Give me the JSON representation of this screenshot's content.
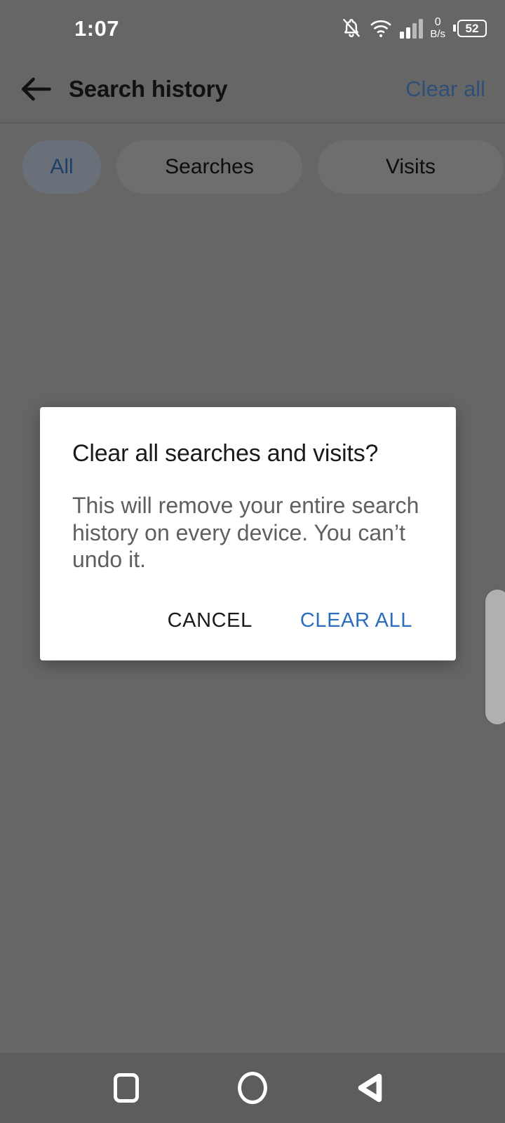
{
  "status_bar": {
    "time": "1:07",
    "network_rate": "0",
    "network_unit": "B/s",
    "battery_level": "52",
    "icons": [
      "notifications-off-icon",
      "wifi-icon",
      "cellular-signal-icon",
      "battery-icon"
    ]
  },
  "app_bar": {
    "back_icon": "arrow-back-icon",
    "title": "Search history",
    "action_label": "Clear all"
  },
  "filters": {
    "chips": [
      {
        "label": "All",
        "selected": true
      },
      {
        "label": "Searches",
        "selected": false
      },
      {
        "label": "Visits",
        "selected": false
      }
    ]
  },
  "dialog": {
    "title": "Clear all searches and visits?",
    "message": "This will remove your entire search history on every device. You can’t undo it.",
    "cancel_label": "CANCEL",
    "confirm_label": "CLEAR ALL"
  },
  "navigation_bar": {
    "recents_icon": "square-recents-icon",
    "home_icon": "circle-home-icon",
    "back_icon": "triangle-back-icon"
  },
  "colors": {
    "scrim": "#666666",
    "dialog_surface": "#ffffff",
    "accent_blue": "#2a6ec0",
    "dimmed_blue": "#2e4f77",
    "nav_bar": "#5d5d5d",
    "chip_selected_bg": "#6a707a",
    "chip_unselected_bg": "#6e6e6e"
  }
}
